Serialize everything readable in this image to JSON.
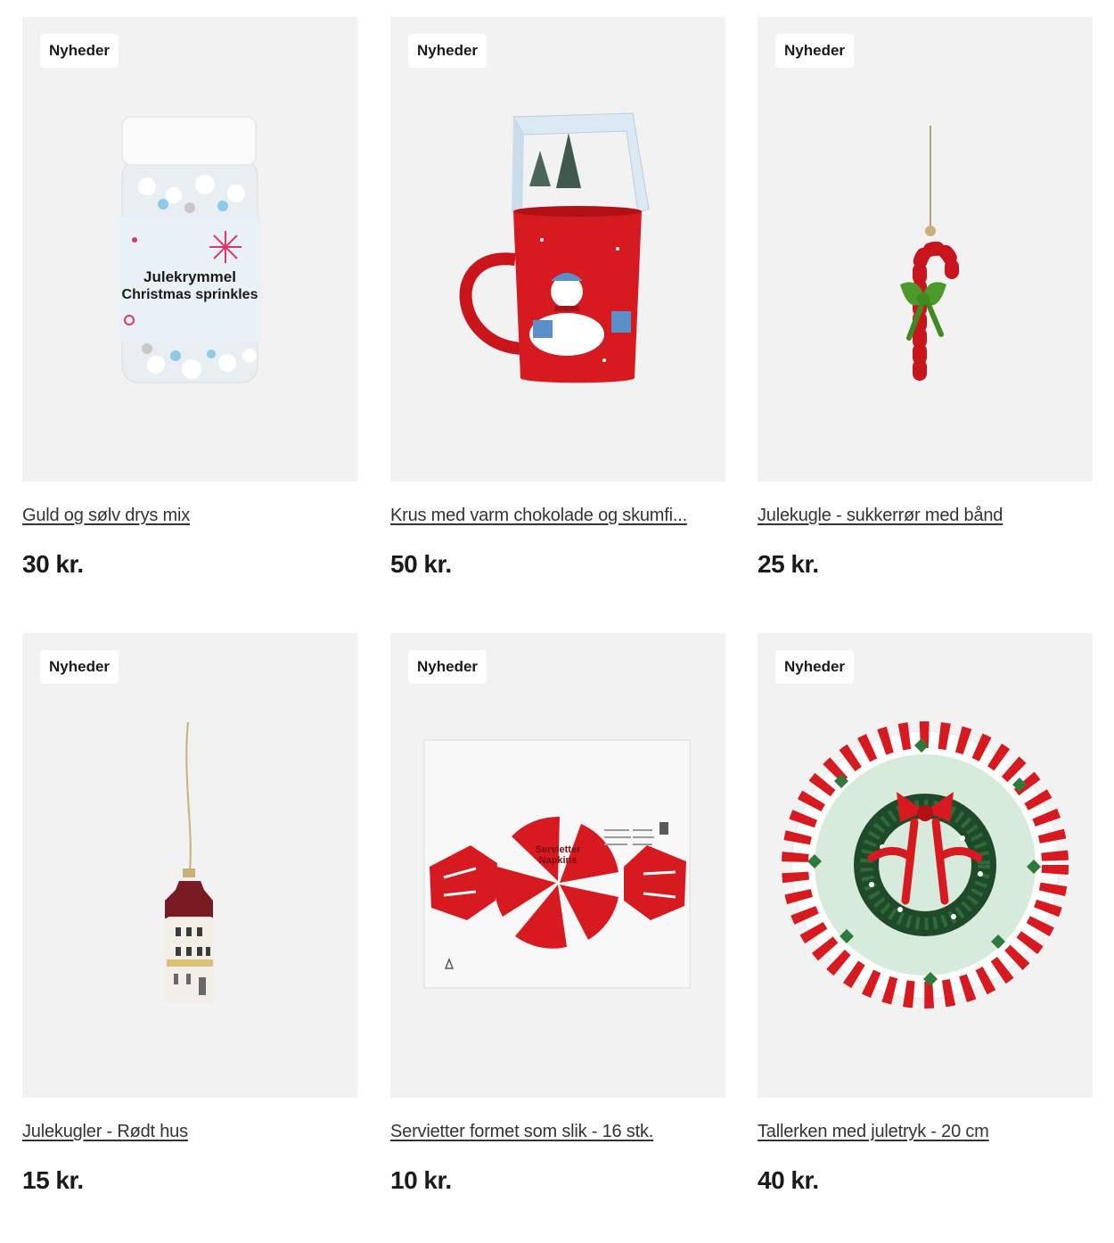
{
  "products": [
    {
      "badge": "Nyheder",
      "title": "Guld og sølv drys mix",
      "price": "30 kr.",
      "label_line1": "Julekrymmel",
      "label_line2": "Christmas sprinkles"
    },
    {
      "badge": "Nyheder",
      "title": "Krus med varm chokolade og skumfi...",
      "price": "50 kr."
    },
    {
      "badge": "Nyheder",
      "title": "Julekugle - sukkerrør med bånd",
      "price": "25 kr."
    },
    {
      "badge": "Nyheder",
      "title": "Julekugler - Rødt hus",
      "price": "15 kr."
    },
    {
      "badge": "Nyheder",
      "title": "Servietter formet som slik - 16 stk.",
      "price": "10 kr.",
      "label_line1": "Servietter",
      "label_line2": "Napkins"
    },
    {
      "badge": "Nyheder",
      "title": "Tallerken med juletryk - 20 cm",
      "price": "40 kr."
    }
  ],
  "colors": {
    "tile_bg": "#f2f2f2",
    "accent_red": "#d71920",
    "text": "#1a1a1a"
  }
}
